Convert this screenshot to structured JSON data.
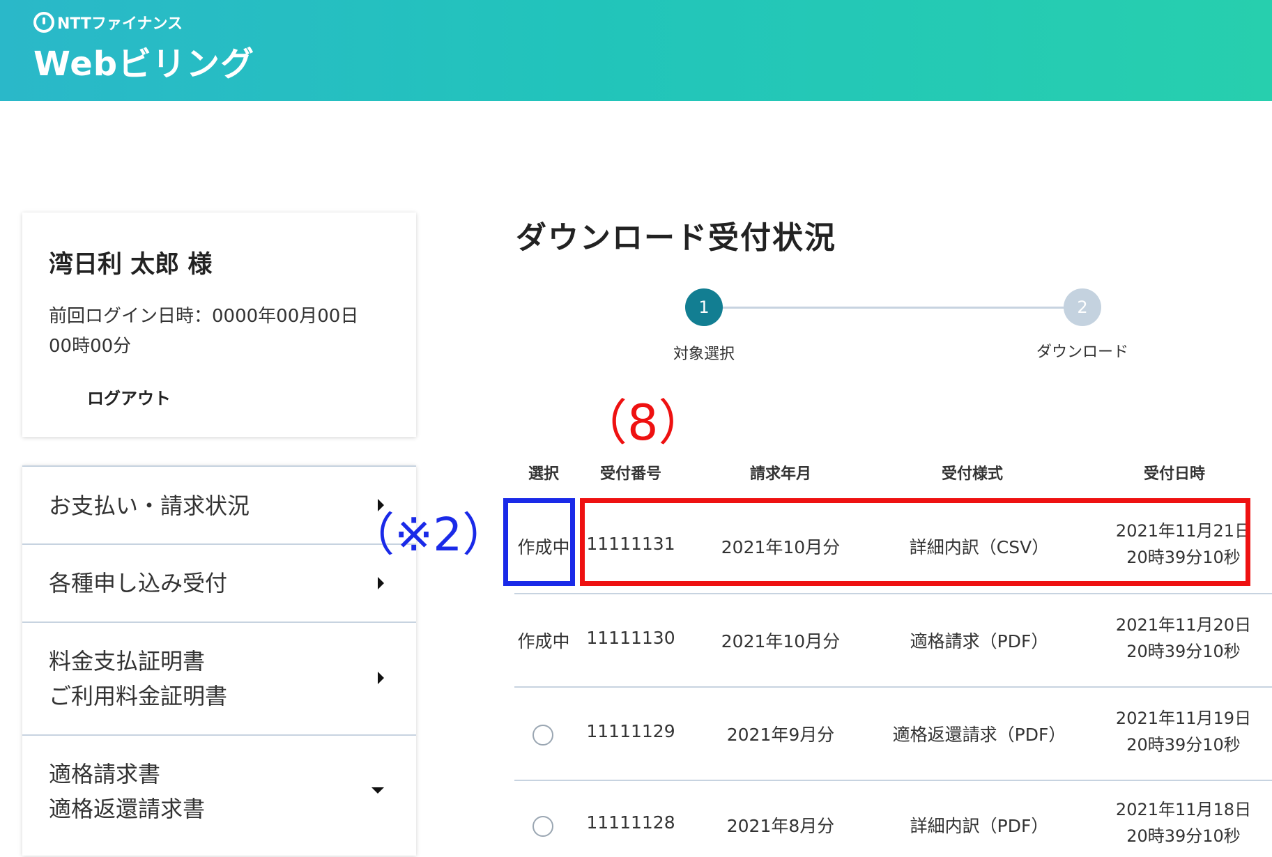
{
  "header": {
    "company": "NTTファイナンス",
    "product": "Webビリング"
  },
  "user": {
    "name": "湾日利 太郎  様",
    "last_login": "前回ログイン日時：0000年00月00日 00時00分",
    "logout": "ログアウト"
  },
  "menu": {
    "items": [
      {
        "label": "お支払い・請求状況",
        "icon": "caret-right-icon"
      },
      {
        "label": "各種申し込み受付",
        "icon": "caret-right-icon"
      },
      {
        "label": "料金支払証明書\nご利用料金証明書",
        "icon": "caret-right-icon"
      },
      {
        "label": "適格請求書\n適格返還請求書",
        "icon": "caret-down-icon"
      }
    ]
  },
  "main": {
    "title": "ダウンロード受付状況",
    "steps": [
      {
        "number": "1",
        "label": "対象選択"
      },
      {
        "number": "2",
        "label": "ダウンロード"
      }
    ]
  },
  "annotations": {
    "red": "（8）",
    "blue": "（※2）"
  },
  "table": {
    "headers": [
      "選択",
      "受付番号",
      "請求年月",
      "受付様式",
      "受付日時"
    ],
    "rows": [
      {
        "select": "作成中",
        "number": "11111131",
        "month": "2021年10月分",
        "format": "詳細内訳（CSV）",
        "date1": "2021年11月21日",
        "date2": "20時39分10秒"
      },
      {
        "select": "作成中",
        "number": "11111130",
        "month": "2021年10月分",
        "format": "適格請求（PDF）",
        "date1": "2021年11月20日",
        "date2": "20時39分10秒"
      },
      {
        "select": "",
        "number": "11111129",
        "month": "2021年9月分",
        "format": "適格返還請求（PDF）",
        "date1": "2021年11月19日",
        "date2": "20時39分10秒"
      },
      {
        "select": "",
        "number": "11111128",
        "month": "2021年8月分",
        "format": "詳細内訳（PDF）",
        "date1": "2021年11月18日",
        "date2": "20時39分10秒"
      }
    ]
  },
  "colors": {
    "header_start": "#2ab8c9",
    "header_end": "#27cfae",
    "step_active": "#127e92",
    "step_inactive": "#c4d2df",
    "annotation_red": "#ee1111",
    "annotation_blue": "#1a2ae8"
  }
}
